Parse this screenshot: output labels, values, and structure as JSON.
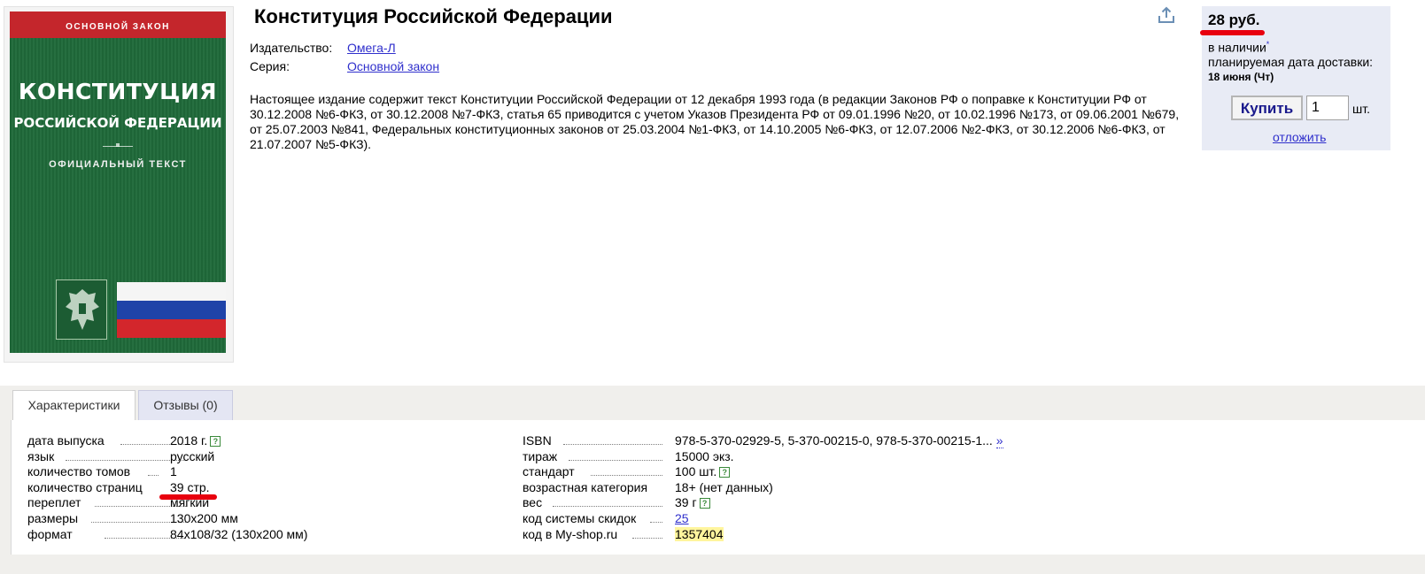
{
  "book": {
    "title": "Конституция Российской Федерации",
    "publisher_label": "Издательство:",
    "publisher": "Омега-Л",
    "series_label": "Серия:",
    "series": "Основной закон",
    "description": "Настоящее издание содержит текст Конституции Российской Федерации от 12 декабря 1993 года (в редакции Законов РФ о поправке к Конституции РФ от 30.12.2008 №6-ФКЗ, от 30.12.2008 №7-ФКЗ, статья 65 приводится с учетом Указов Президента РФ от 09.01.1996 №20, от 10.02.1996 №173, от 09.06.2001 №679, от 25.07.2003 №841, Федеральных конституционных законов от 25.03.2004 №1-ФКЗ, от 14.10.2005 №6-ФКЗ, от 12.07.2006 №2-ФКЗ, от 30.12.2006 №6-ФКЗ, от 21.07.2007 №5-ФКЗ)."
  },
  "cover": {
    "top_band": "ОСНОВНОЙ ЗАКОН",
    "title": "КОНСТИТУЦИЯ",
    "subtitle": "РОССИЙСКОЙ ФЕДЕРАЦИИ",
    "official": "ОФИЦИАЛЬНЫЙ ТЕКСТ"
  },
  "buy": {
    "price": "28 руб.",
    "availability": "в наличии",
    "availability_mark": "*",
    "delivery_label": "планируемая дата доставки:",
    "delivery_date": "18 июня (Чт)",
    "buy_label": "Купить",
    "quantity": "1",
    "unit": "шт.",
    "defer_label": "отложить"
  },
  "tabs": [
    {
      "label": "Характеристики",
      "active": true
    },
    {
      "label": "Отзывы (0)",
      "active": false
    }
  ],
  "specs_left": [
    {
      "label": "дата выпуска",
      "value": "2018 г.",
      "help": true
    },
    {
      "label": "язык",
      "value": "русский"
    },
    {
      "label": "количество томов",
      "value": "1"
    },
    {
      "label": "количество страниц",
      "value": "39 стр."
    },
    {
      "label": "переплет",
      "value": "мягкий"
    },
    {
      "label": "размеры",
      "value": "130x200 мм"
    },
    {
      "label": "формат",
      "value": "84x108/32 (130x200 мм)"
    }
  ],
  "specs_right": [
    {
      "label": "ISBN",
      "value": "978-5-370-02929-5, 5-370-00215-0, 978-5-370-00215-1...",
      "more": "»"
    },
    {
      "label": "тираж",
      "value": "15000 экз."
    },
    {
      "label": "стандарт",
      "value": "100 шт.",
      "help": true
    },
    {
      "label": "возрастная категория",
      "value": "18+ (нет данных)"
    },
    {
      "label": "вес",
      "value": "39 г",
      "help": true
    },
    {
      "label": "код системы скидок",
      "value": "25",
      "link": true
    },
    {
      "label": "код в My-shop.ru",
      "value": "1357404",
      "highlight": true
    }
  ],
  "help_glyph": "?",
  "colors": {
    "link": "#2f2fcc",
    "cover_green": "#1f6a3a",
    "cover_red": "#c4262c",
    "buy_box_bg": "#e8ebf5",
    "annotation_red": "#e8000e",
    "highlight_yellow": "#fff59d"
  }
}
